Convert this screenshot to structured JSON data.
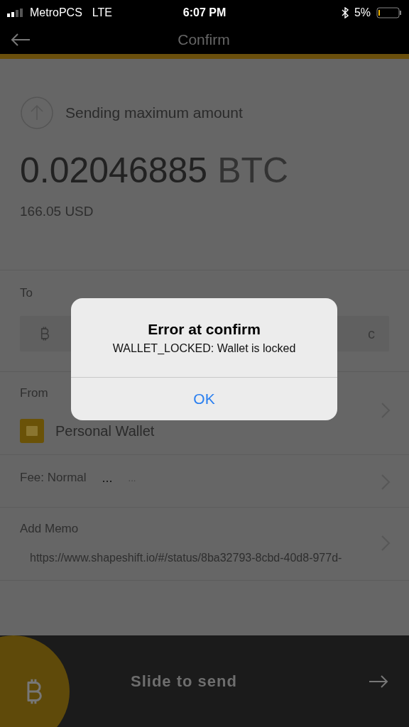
{
  "status_bar": {
    "carrier": "MetroPCS",
    "network": "LTE",
    "time": "6:07 PM",
    "battery": "5%"
  },
  "nav": {
    "title": "Confirm"
  },
  "summary": {
    "note": "Sending maximum amount",
    "amount": "0.02046885",
    "unit": "BTC",
    "fiat": "166.05 USD"
  },
  "to": {
    "label": "To",
    "address_tail": "c"
  },
  "from": {
    "label": "From",
    "wallet": "Personal Wallet"
  },
  "fee": {
    "label": "Fee: Normal",
    "value": "...",
    "fiat": "..."
  },
  "memo": {
    "label": "Add Memo",
    "value": "https://www.shapeshift.io/#/status/8ba32793-8cbd-40d8-977d-"
  },
  "slider": {
    "label": "Slide to send"
  },
  "dialog": {
    "title": "Error at confirm",
    "message": "WALLET_LOCKED: Wallet is locked",
    "button": "OK"
  }
}
